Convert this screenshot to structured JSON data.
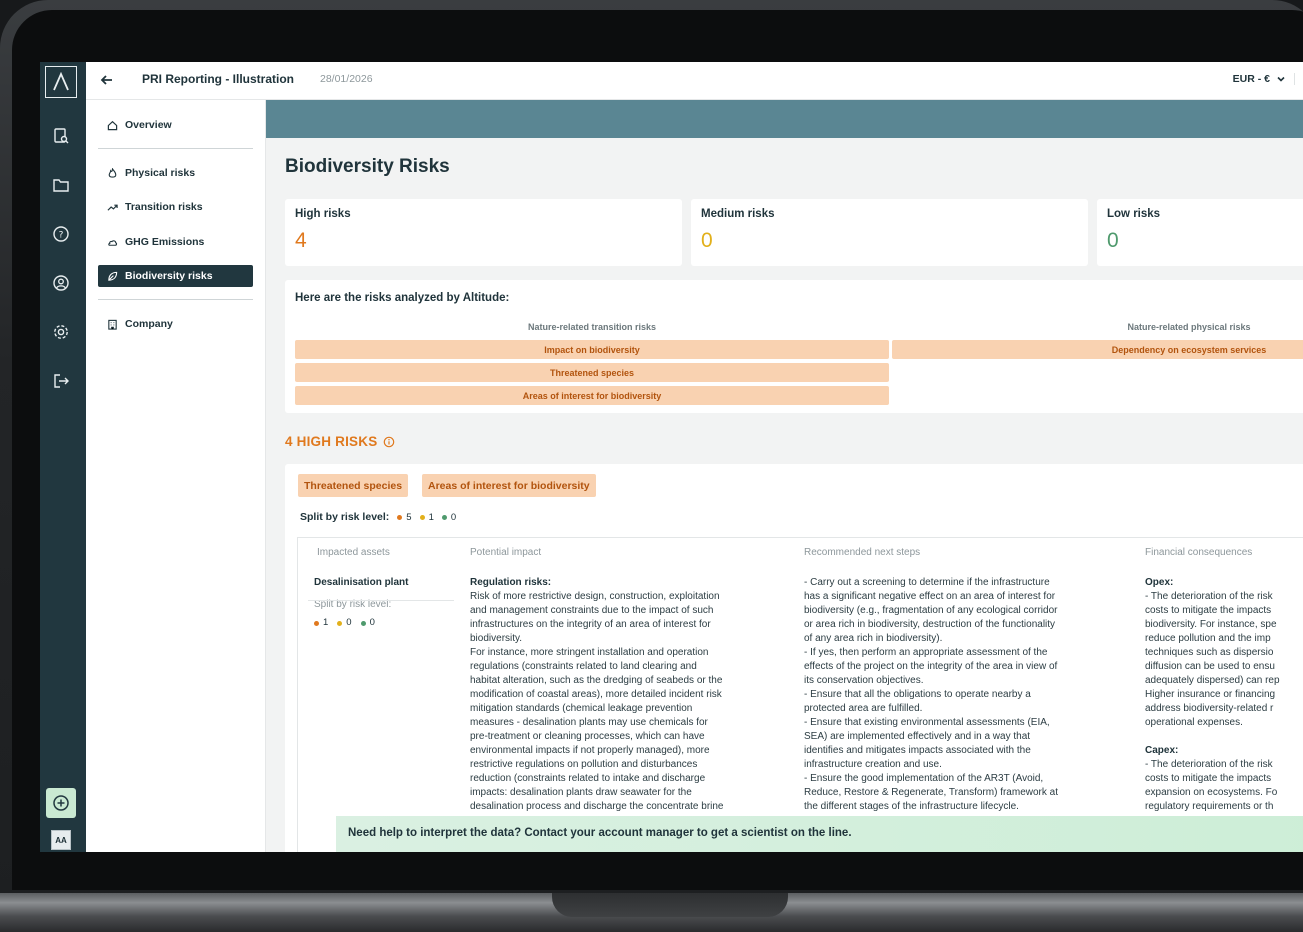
{
  "app": {
    "title": "PRI Reporting - Illustration",
    "date": "28/01/2026",
    "currency": "EUR - €"
  },
  "rail": {
    "logo": "Λ",
    "icons": [
      "report-search-icon",
      "folder-icon",
      "help-icon",
      "account-icon",
      "settings-icon",
      "logout-icon"
    ],
    "avatar": "AA"
  },
  "sidebar": {
    "items": [
      {
        "label": "Overview",
        "icon": "home-icon"
      },
      {
        "label": "Physical risks",
        "icon": "flame-icon"
      },
      {
        "label": "Transition risks",
        "icon": "trend-icon"
      },
      {
        "label": "GHG Emissions",
        "icon": "cloud-icon"
      },
      {
        "label": "Biodiversity risks",
        "icon": "leaf-icon",
        "active": true
      },
      {
        "label": "Company",
        "icon": "building-icon"
      }
    ]
  },
  "main": {
    "title": "Biodiversity Risks",
    "stats": [
      {
        "label": "High risks",
        "value": "4",
        "color": "#e0791e"
      },
      {
        "label": "Medium risks",
        "value": "0",
        "color": "#e2b01b"
      },
      {
        "label": "Low risks",
        "value": "0",
        "color": "#4f9a6d"
      }
    ],
    "analyzed": {
      "title": "Here are the risks analyzed by Altitude:",
      "transition_head": "Nature-related transition risks",
      "physical_head": "Nature-related physical risks",
      "transition": [
        "Impact on biodiversity",
        "Threatened species",
        "Areas of interest for biodiversity"
      ],
      "physical": [
        "Dependency on ecosystem services"
      ]
    },
    "high": {
      "heading": "4 HIGH RISKS",
      "tags": [
        "Threatened species",
        "Areas of interest for biodiversity"
      ],
      "split_label": "Split by risk level:",
      "split": [
        "5",
        "1",
        "0"
      ],
      "columns": [
        "Impacted assets",
        "Potential impact",
        "Recommended next steps",
        "Financial consequences"
      ],
      "row": {
        "asset": "Desalinisation plant",
        "asset_split_label": "Split by risk level:",
        "asset_split": [
          "1",
          "0",
          "0"
        ],
        "impact_title": "Regulation risks:",
        "impact_lines": [
          "Risk of more restrictive design, construction, exploitation",
          "and management constraints due to the impact of such",
          "infrastructures on the integrity of an area of interest for",
          "biodiversity.",
          "For instance, more stringent installation and operation",
          "regulations (constraints related to land clearing and",
          "habitat alteration, such as the dredging of seabeds or the",
          "modification of coastal areas), more detailed incident risk",
          "mitigation standards (chemical leakage prevention",
          "measures - desalination plants may use chemicals for",
          "pre-treatment or cleaning processes, which can have",
          "environmental impacts if not properly managed), more",
          "restrictive regulations on pollution and disturbances",
          "reduction (constraints related to intake and discharge",
          "impacts: desalination plants draw seawater for the",
          "desalination process and discharge the concentrate brine"
        ],
        "steps_lines": [
          "- Carry out a screening to determine if the infrastructure",
          "has a significant negative effect on an area of interest for",
          "biodiversity (e.g., fragmentation of any ecological corridor",
          "or area rich in biodiversity, destruction of the functionality",
          "of any area rich in biodiversity).",
          "- If yes, then perform an appropriate assessment of the",
          "effects of the project on the integrity of the area in view of",
          "its conservation objectives.",
          "- Ensure that all the obligations to operate nearby a",
          "protected area are fulfilled.",
          "- Ensure that existing environmental assessments (EIA,",
          "SEA) are implemented effectively and in a way that",
          "identifies and mitigates impacts associated with the",
          "infrastructure creation and use.",
          "- Ensure the good implementation of the AR3T (Avoid,",
          "Reduce, Restore & Regenerate, Transform) framework at",
          "the different stages of the infrastructure lifecycle."
        ],
        "opex_title": "Opex:",
        "opex_lines": [
          "- The deterioration of the risk",
          "costs to mitigate the impacts",
          "biodiversity. For instance, spe",
          "reduce pollution and the imp",
          "techniques such as dispersio",
          "diffusion can be used to ensu",
          "adequately dispersed) can rep",
          "Higher insurance or financing",
          "address biodiversity-related r",
          "operational expenses."
        ],
        "capex_title": "Capex:",
        "capex_lines": [
          "- The deterioration of the risk",
          "costs to mitigate the impacts",
          "expansion on ecosystems. Fo",
          "regulatory requirements or th"
        ]
      }
    },
    "help": "Need help to interpret the data? Contact your account manager to get a scientist on the line."
  },
  "colors": {
    "dark": "#21373f",
    "banner": "#5a8693",
    "high": "#e0791e",
    "medium": "#e2b01b",
    "low": "#4f9a6d",
    "pill": "#f9d2b1"
  }
}
